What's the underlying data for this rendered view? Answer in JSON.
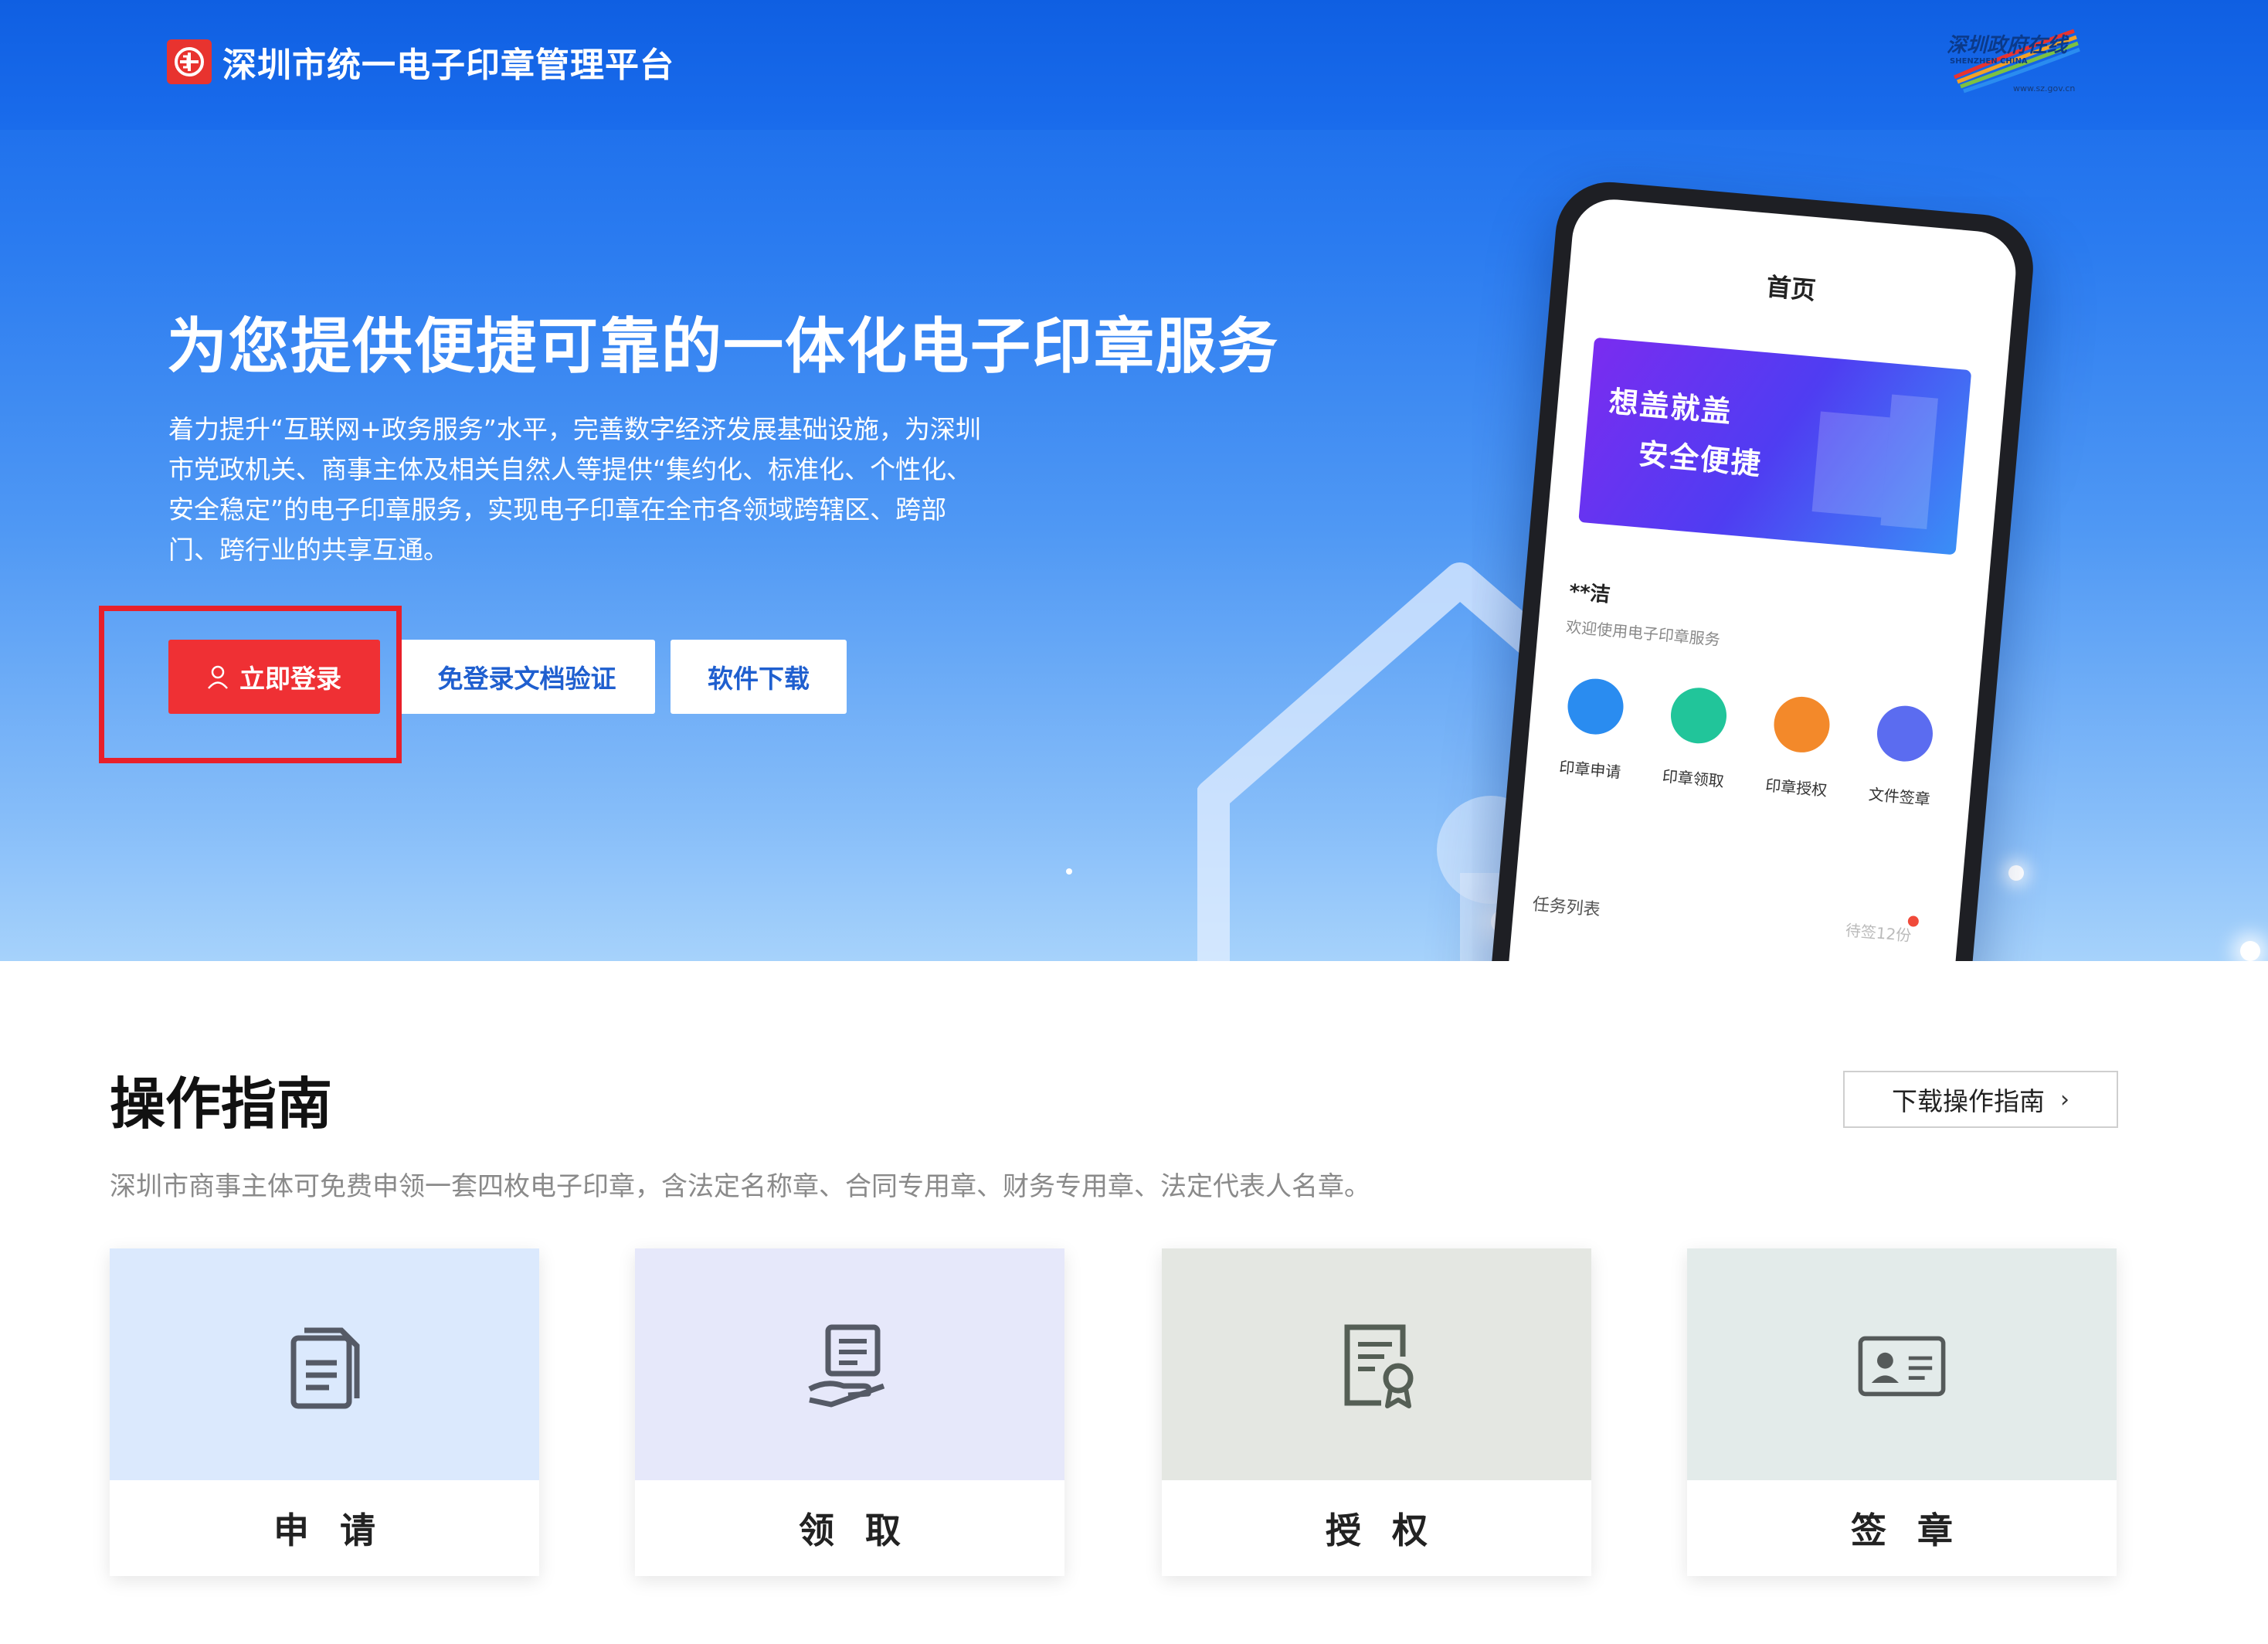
{
  "header": {
    "brand_name": "深圳市统一电子印章管理平台",
    "gov_logo_text": "深圳政府在线",
    "gov_logo_sub": "SHENZHEN CHINA",
    "gov_logo_url": "www.sz.gov.cn"
  },
  "hero": {
    "title": "为您提供便捷可靠的一体化电子印章服务",
    "description": "着力提升“互联网+政务服务”水平，完善数字经济发展基础设施，为深圳市党政机关、商事主体及相关自然人等提供“集约化、标准化、个性化、安全稳定”的电子印章服务，实现电子印章在全市各领域跨辖区、跨部门、跨行业的共享互通。",
    "buttons": {
      "login": "立即登录",
      "verify": "免登录文档验证",
      "download": "软件下载"
    }
  },
  "phone": {
    "title": "首页",
    "banner_line1": "想盖就盖",
    "banner_line2": "安全便捷",
    "user": "**洁",
    "welcome": "欢迎使用电子印章服务",
    "icons": [
      {
        "label": "印章申请",
        "color": "#2a8cf0"
      },
      {
        "label": "印章领取",
        "color": "#21c59a"
      },
      {
        "label": "印章授权",
        "color": "#f3892a"
      },
      {
        "label": "文件签章",
        "color": "#5b6cf0"
      }
    ],
    "task_list": "任务列表",
    "pending": "待签12份"
  },
  "guide": {
    "title": "操作指南",
    "download_button": "下载操作指南",
    "subtitle": "深圳市商事主体可免费申领一套四枚电子印章，含法定名称章、合同专用章、财务专用章、法定代表人名章。",
    "cards": [
      {
        "label": "申请",
        "bg": "#dbe9fd",
        "icon": "document-icon"
      },
      {
        "label": "领取",
        "bg": "#e6e8fa",
        "icon": "hand-receive-icon"
      },
      {
        "label": "授权",
        "bg": "#e4e7e2",
        "icon": "certificate-icon"
      },
      {
        "label": "签章",
        "bg": "#e3ebea",
        "icon": "id-card-icon"
      }
    ]
  }
}
